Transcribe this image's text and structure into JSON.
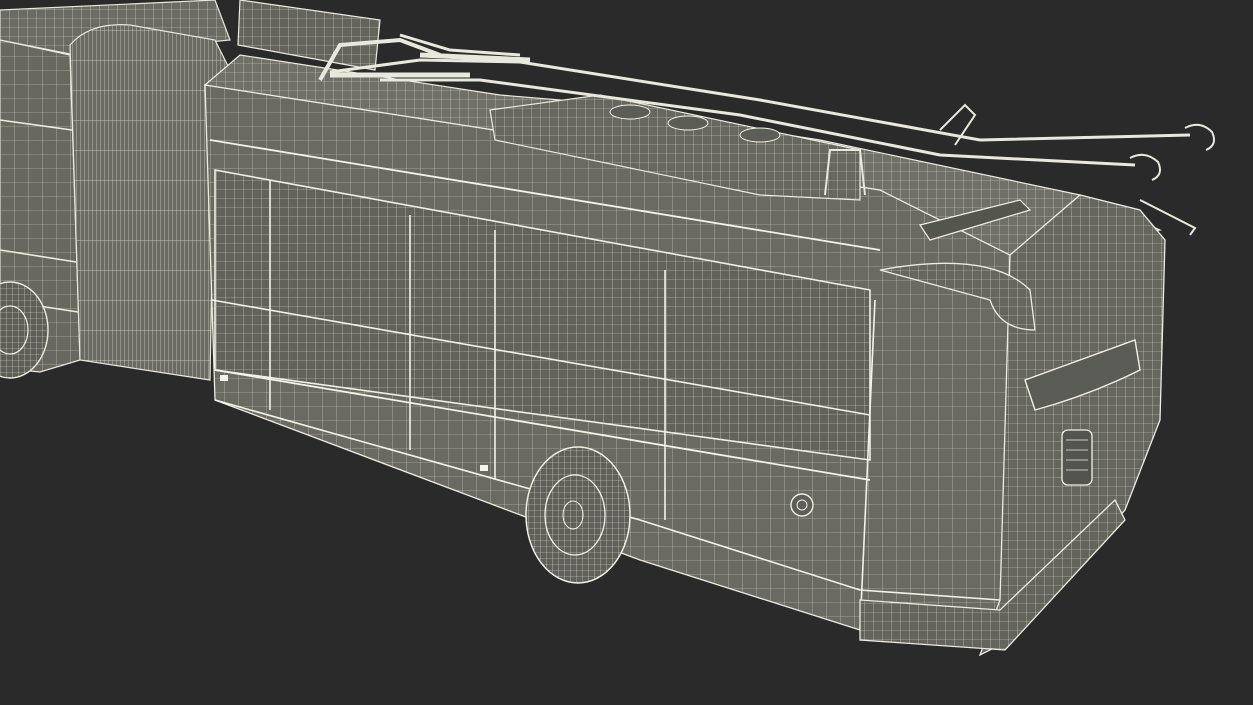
{
  "scene": {
    "subject": "trolleybus-wireframe-model",
    "background_color": "#2a2a2a",
    "body_fill_color": "#6b6b65",
    "body_fill_dark": "#5a5a55",
    "wire_color": "#e8e8dc",
    "wire_minor_color": "#cfcfc2"
  }
}
